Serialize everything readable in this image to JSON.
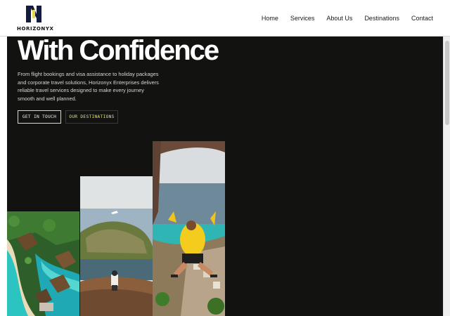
{
  "brand": {
    "name": "HORIZONYX",
    "colors": {
      "mark_dark": "#141c3e",
      "mark_accent": "#e8d84a",
      "hero_bg": "#121310",
      "cta_accent": "#e3e062"
    }
  },
  "nav": {
    "items": [
      {
        "label": "Home"
      },
      {
        "label": "Services"
      },
      {
        "label": "About Us"
      },
      {
        "label": "Destinations"
      },
      {
        "label": "Contact"
      }
    ]
  },
  "hero": {
    "title": "With Confidence",
    "description": "From flight bookings and visa assistance to holiday packages and corporate travel solutions, Horizonyx Enterprises delivers reliable travel services designed to make every journey smooth and well planned.",
    "primary_button": "GET IN TOUCH",
    "secondary_button": "OUR DESTINATIONS"
  },
  "gallery": {
    "photos": [
      {
        "subject": "tropical-resort-aerial"
      },
      {
        "subject": "island-bay-view"
      },
      {
        "subject": "jumping-traveler-cave"
      }
    ]
  }
}
